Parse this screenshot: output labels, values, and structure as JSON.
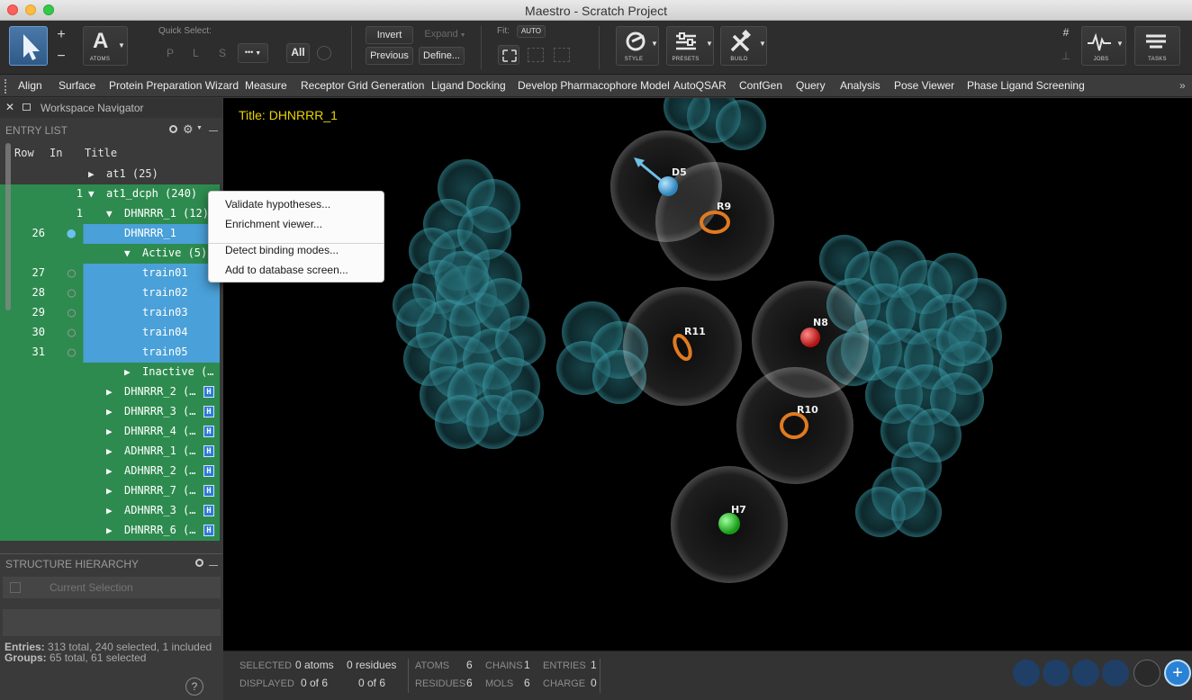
{
  "window": {
    "title": "Maestro - Scratch Project"
  },
  "toolbar": {
    "atoms_label": "ATOMS",
    "quick_select_label": "Quick Select:",
    "qs_letters": [
      "P",
      "L",
      "S"
    ],
    "more_label": "•••",
    "all_label": "All",
    "invert_label": "Invert",
    "expand_label": "Expand",
    "previous_label": "Previous",
    "define_label": "Define...",
    "fit_label": "Fit:",
    "auto_label": "AUTO",
    "style_label": "STYLE",
    "presets_label": "PRESETS",
    "build_label": "BUILD",
    "jobs_label": "JOBS",
    "tasks_label": "TASKS"
  },
  "menubar": [
    "Align",
    "Surface",
    "Protein Preparation Wizard",
    "Measure",
    "Receptor Grid Generation",
    "Ligand Docking",
    "Develop Pharmacophore Model",
    "AutoQSAR",
    "ConfGen",
    "Query",
    "Analysis",
    "Pose Viewer",
    "Phase Ligand Screening"
  ],
  "navigator": {
    "title": "Workspace Navigator",
    "entry_list_label": "ENTRY LIST",
    "columns": {
      "row": "Row",
      "in": "In",
      "title": "Title"
    },
    "rows": [
      {
        "row": "",
        "in": "",
        "title": "at1 (25)",
        "arrow": "▶",
        "indent": 0,
        "state": "plain"
      },
      {
        "row": "",
        "in": "1",
        "title": "at1_dcph (240)",
        "arrow": "▼",
        "indent": 0,
        "state": "green"
      },
      {
        "row": "",
        "in": "1",
        "title": "DHNRRR_1 (12)",
        "arrow": "▼",
        "indent": 1,
        "state": "green"
      },
      {
        "row": "26",
        "in": "●",
        "title": "DHNRRR_1",
        "arrow": "",
        "indent": 2,
        "state": "blue"
      },
      {
        "row": "",
        "in": "",
        "title": "Active (5)",
        "arrow": "▼",
        "indent": 2,
        "state": "green"
      },
      {
        "row": "27",
        "in": "○",
        "title": "train01",
        "arrow": "",
        "indent": 3,
        "state": "blue"
      },
      {
        "row": "28",
        "in": "○",
        "title": "train02",
        "arrow": "",
        "indent": 3,
        "state": "blue"
      },
      {
        "row": "29",
        "in": "○",
        "title": "train03",
        "arrow": "",
        "indent": 3,
        "state": "blue"
      },
      {
        "row": "30",
        "in": "○",
        "title": "train04",
        "arrow": "",
        "indent": 3,
        "state": "blue"
      },
      {
        "row": "31",
        "in": "○",
        "title": "train05",
        "arrow": "",
        "indent": 3,
        "state": "blue"
      },
      {
        "row": "",
        "in": "",
        "title": "Inactive (…",
        "arrow": "▶",
        "indent": 2,
        "state": "green"
      },
      {
        "row": "",
        "in": "",
        "title": "DHNRRR_2 (…",
        "arrow": "▶",
        "indent": 1,
        "state": "green",
        "badge": "H"
      },
      {
        "row": "",
        "in": "",
        "title": "DHNRRR_3 (…",
        "arrow": "▶",
        "indent": 1,
        "state": "green",
        "badge": "H"
      },
      {
        "row": "",
        "in": "",
        "title": "DHNRRR_4 (…",
        "arrow": "▶",
        "indent": 1,
        "state": "green",
        "badge": "H"
      },
      {
        "row": "",
        "in": "",
        "title": "ADHNRR_1 (…",
        "arrow": "▶",
        "indent": 1,
        "state": "green",
        "badge": "H"
      },
      {
        "row": "",
        "in": "",
        "title": "ADHNRR_2 (…",
        "arrow": "▶",
        "indent": 1,
        "state": "green",
        "badge": "H"
      },
      {
        "row": "",
        "in": "",
        "title": "DHNRRR_7 (…",
        "arrow": "▶",
        "indent": 1,
        "state": "green",
        "badge": "H"
      },
      {
        "row": "",
        "in": "",
        "title": "ADHNRR_3 (…",
        "arrow": "▶",
        "indent": 1,
        "state": "green",
        "badge": "H"
      },
      {
        "row": "",
        "in": "",
        "title": "DHNRRR_6 (…",
        "arrow": "▶",
        "indent": 1,
        "state": "green",
        "badge": "H"
      }
    ],
    "structure_hierarchy_label": "STRUCTURE HIERARCHY",
    "current_selection_label": "Current Selection",
    "entries_label": "Entries:",
    "entries_value": "313 total, 240 selected, 1 included",
    "groups_label": "Groups:",
    "groups_value": "65 total, 61 selected",
    "help_label": "?"
  },
  "viewport": {
    "title": "Title: DHNRRR_1",
    "features": [
      "D5",
      "R9",
      "N8",
      "R11",
      "R10",
      "H7"
    ]
  },
  "context_menu": {
    "items": [
      "Validate hypotheses...",
      "Enrichment viewer...",
      "Detect binding modes...",
      "Add to database screen..."
    ]
  },
  "statusbar": {
    "selected_label": "SELECTED",
    "selected_atoms": "0 atoms",
    "selected_residues": "0 residues",
    "displayed_label": "DISPLAYED",
    "displayed_atoms": "0 of 6",
    "displayed_residues": "0 of 6",
    "atoms_label": "ATOMS",
    "atoms_value": "6",
    "chains_label": "CHAINS",
    "chains_value": "1",
    "entries_label": "ENTRIES",
    "entries_value": "1",
    "residues_label": "RESIDUES",
    "residues_value": "6",
    "mols_label": "MOLS",
    "mols_value": "6",
    "charge_label": "CHARGE",
    "charge_value": "0"
  },
  "colors": {
    "green_row": "#2e8b4f",
    "blue_row": "#4aa0d8",
    "viewport_title": "#e8d400",
    "ring": "#e07a20",
    "acceptor": "#3fa3d6",
    "negative": "#d92b2b",
    "hydrophobic": "#2fb52f",
    "cloud": "#1f5b63"
  }
}
